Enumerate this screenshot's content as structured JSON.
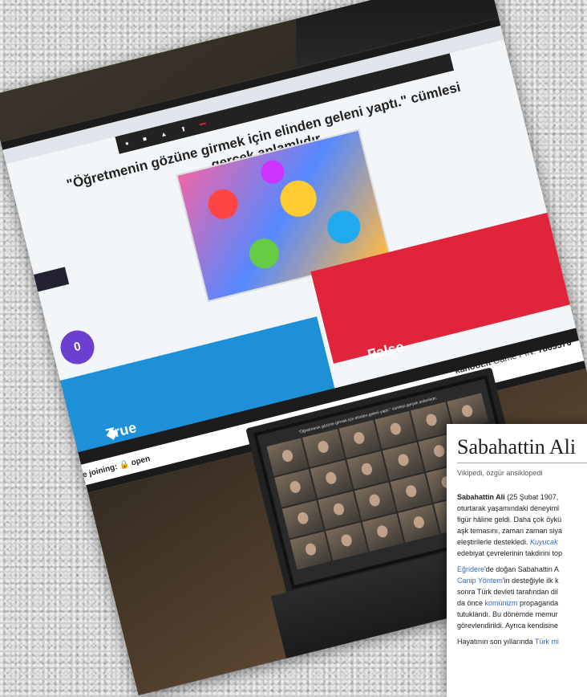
{
  "kahoot": {
    "question": "\"Öğretmenin gözüne girmek için elinden geleni yaptı.\" cümlesi gerçek anlamlıdır.",
    "timer": "0",
    "answer_true": "True",
    "answer_false": "False",
    "footer_site": "kahoot.it",
    "footer_pin_label": "Game PIN:",
    "footer_pin": "7805576",
    "joining_label": "me joining:",
    "joining_status": "open"
  },
  "wiki": {
    "title": "Sabahattin Ali",
    "subtitle": "Vikipedi, özgür ansiklopedi",
    "p1": [
      {
        "bold": "Sabahattin Ali",
        "text": " (25 Şubat 1907,"
      },
      {
        "text": "oturtarak yaşamındaki deneyiml"
      },
      {
        "text": "figür hâline geldi. Daha çok öykü"
      },
      {
        "text": "aşk temasını, zaman zaman siya"
      },
      {
        "text": "eleştirilerle destekledi. ",
        "italic_link": "Kuyucak"
      },
      {
        "text": "edebiyat çevrelerinin takdirini top"
      }
    ],
    "p2": [
      {
        "link": "Eğridere",
        "text": "'de doğan Sabahattin A"
      },
      {
        "link": "Canip Yöntem",
        "text": "'in desteğiyle ilk k"
      },
      {
        "text": "sonra Türk devleti tarafından dil"
      },
      {
        "text": "da önce ",
        "link_inline": "komünizm",
        "text2": " propaganda"
      },
      {
        "text": "tutuklandı. Bu dönemde memur"
      },
      {
        "text": "görevlendirildi. Ayrıca kendisine"
      }
    ],
    "p3": {
      "text": "Hayatının son yıllarında ",
      "link": "Türk mi"
    }
  }
}
